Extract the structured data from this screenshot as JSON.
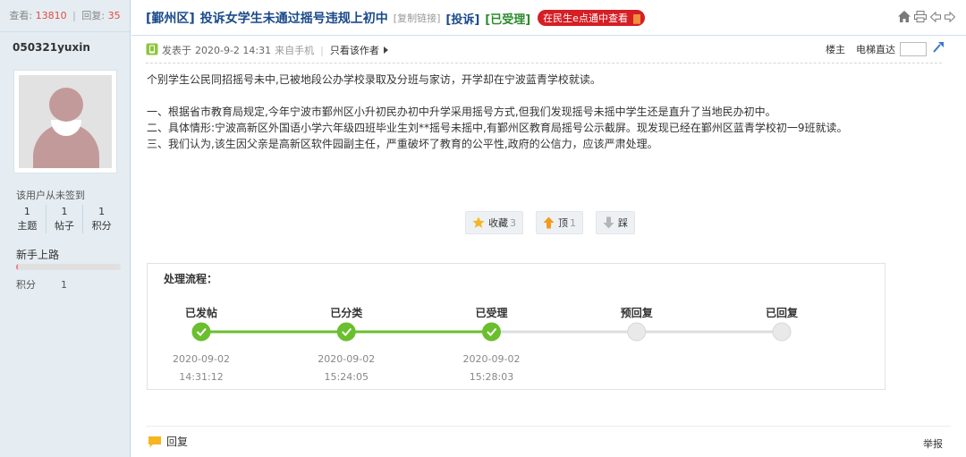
{
  "sidebar": {
    "views_label": "查看:",
    "views": "13810",
    "sep": "|",
    "replies_label": "回复:",
    "replies": "35",
    "username": "050321yuxin",
    "sign_status": "该用户从未签到",
    "counts": [
      {
        "value": "1",
        "label": "主题"
      },
      {
        "value": "1",
        "label": "帖子"
      },
      {
        "value": "1",
        "label": "积分"
      }
    ],
    "rank": "新手上路",
    "rank_progress_percent": 2,
    "points_label": "积分",
    "points_value": "1"
  },
  "thread": {
    "region": "[鄞州区]",
    "title": "投诉女学生未通过摇号违规上初中",
    "copy_link": "[复制链接]",
    "type": "[投诉]",
    "status": "[已受理]",
    "badge": "在民生e点通中查看",
    "badge_bars": "||||"
  },
  "post": {
    "posted_label": "发表于",
    "posted_time": "2020-9-2 14:31",
    "source": "来自手机",
    "author_only": "只看该作者",
    "floor": "楼主",
    "elevator": "电梯直达",
    "paragraphs": [
      "个别学生公民同招摇号未中,已被地段公办学校录取及分班与家访，开学却在宁波蓝青学校就读。",
      "",
      "一、根据省市教育局规定,今年宁波市鄞州区小升初民办初中升学采用摇号方式,但我们发现摇号未摇中学生还是直升了当地民办初中。",
      "二、具体情形:宁波高新区外国语小学六年级四班毕业生刘**摇号未摇中,有鄞州区教育局摇号公示截屏。现发现已经在鄞州区蓝青学校初一9班就读。",
      "三、我们认为,该生因父亲是高新区软件园副主任，严重破坏了教育的公平性,政府的公信力，应该严肃处理。"
    ],
    "actions": {
      "favorite_label": "收藏",
      "favorite_count": "3",
      "up_label": "顶",
      "up_count": "1",
      "down_label": "踩"
    }
  },
  "flow": {
    "title": "处理流程：",
    "steps": [
      {
        "label": "已发帖",
        "date": "2020-09-02",
        "time": "14:31:12",
        "done": true
      },
      {
        "label": "已分类",
        "date": "2020-09-02",
        "time": "15:24:05",
        "done": true
      },
      {
        "label": "已受理",
        "date": "2020-09-02",
        "time": "15:28:03",
        "done": true
      },
      {
        "label": "预回复",
        "date": "",
        "time": "",
        "done": false
      },
      {
        "label": "已回复",
        "date": "",
        "time": "",
        "done": false
      }
    ],
    "colors": {
      "done": "#6abf2e",
      "pending": "#dddddd"
    }
  },
  "footer": {
    "reply": "回复",
    "report": "举报"
  },
  "icons": {
    "home": "home-icon",
    "print": "print-icon",
    "prev": "prev-thread-icon",
    "next": "next-thread-icon",
    "phone": "phone-icon",
    "favorite": "star-icon",
    "up": "arrow-up-icon",
    "down": "arrow-down-icon",
    "reply": "comment-icon",
    "elevator": "elevator-go-icon"
  }
}
